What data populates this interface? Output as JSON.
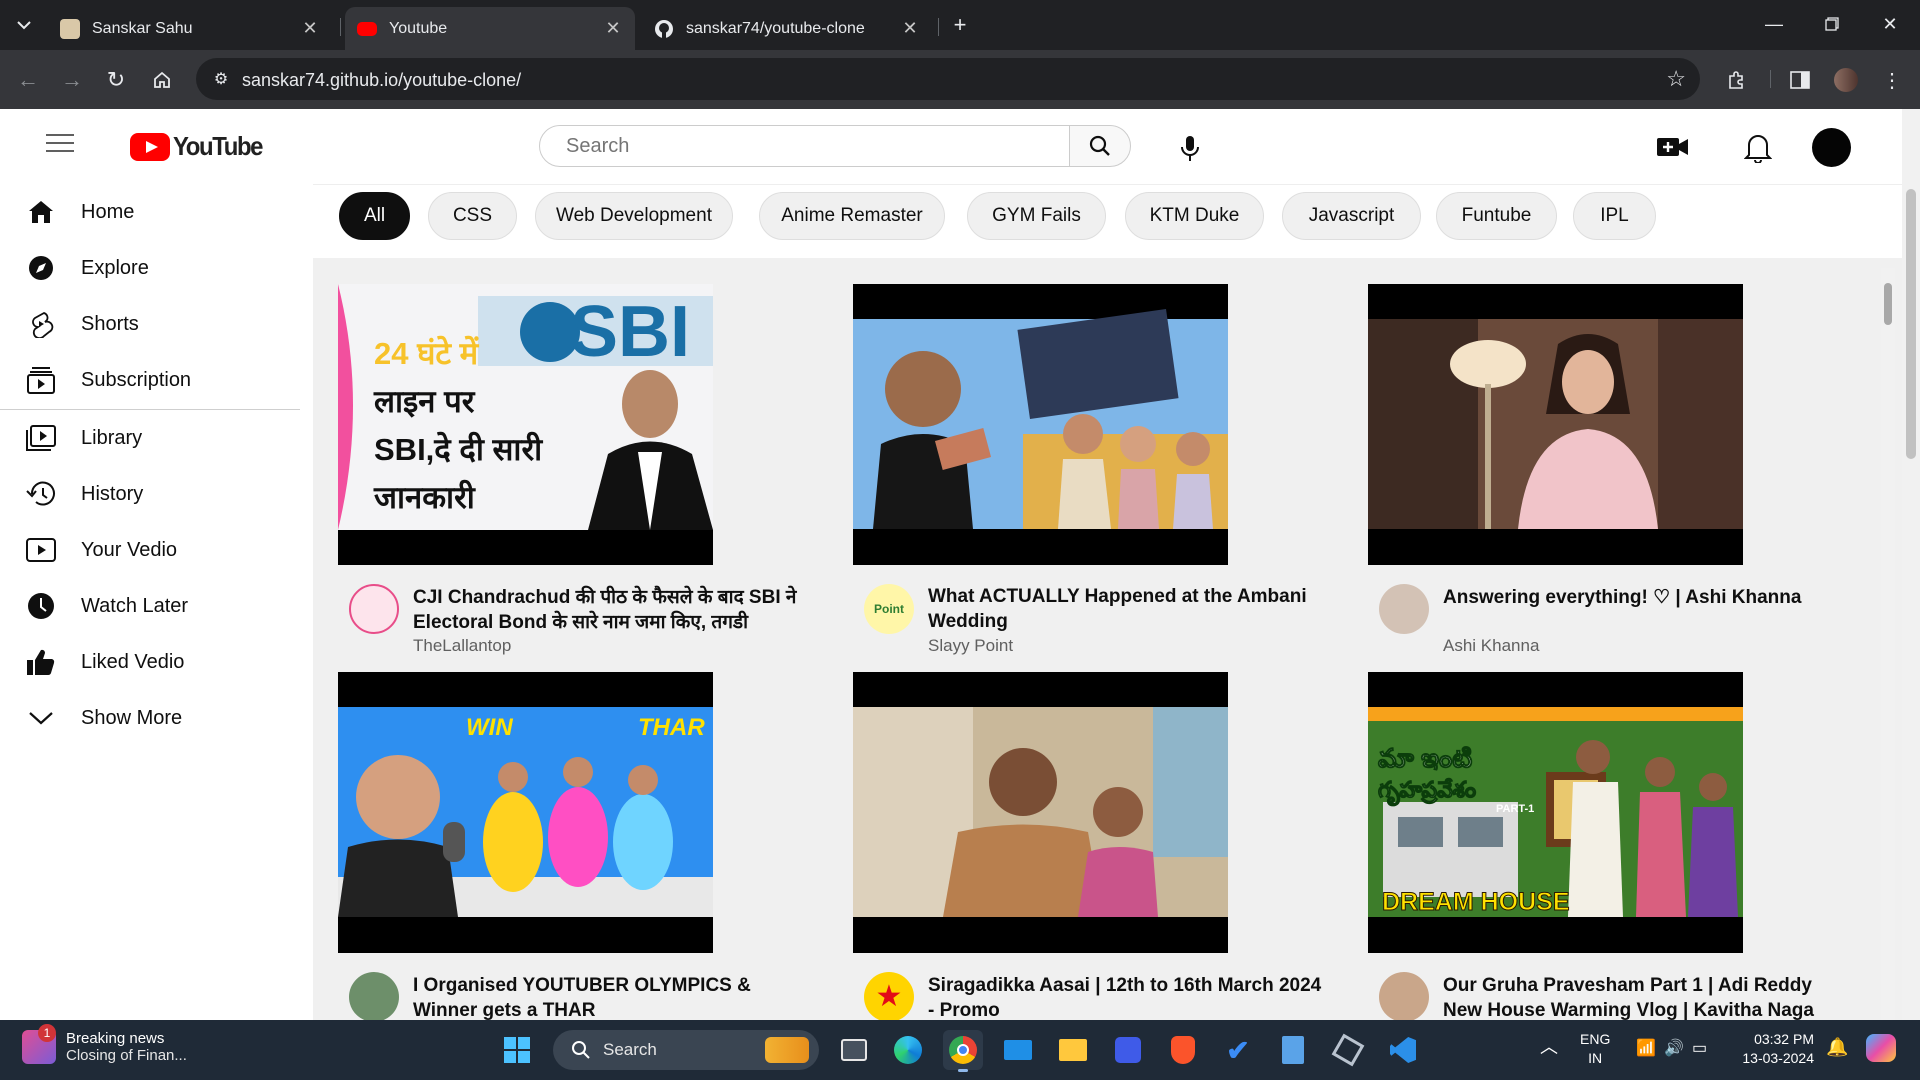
{
  "browser": {
    "tabs": [
      {
        "title": "Sanskar Sahu",
        "active": false
      },
      {
        "title": "Youtube",
        "active": true
      },
      {
        "title": "sanskar74/youtube-clone",
        "active": false
      }
    ],
    "url": "sanskar74.github.io/youtube-clone/"
  },
  "header": {
    "logo_text": "YouTube",
    "search_placeholder": "Search"
  },
  "sidebar": {
    "items": [
      {
        "label": "Home",
        "icon": "home-icon"
      },
      {
        "label": "Explore",
        "icon": "compass-icon"
      },
      {
        "label": "Shorts",
        "icon": "shorts-icon"
      },
      {
        "label": "Subscription",
        "icon": "subscriptions-icon"
      },
      {
        "label": "Library",
        "icon": "library-icon"
      },
      {
        "label": "History",
        "icon": "history-icon"
      },
      {
        "label": "Your Vedio",
        "icon": "your-video-icon"
      },
      {
        "label": "Watch Later",
        "icon": "watch-later-icon"
      },
      {
        "label": "Liked Vedio",
        "icon": "thumbs-up-icon"
      },
      {
        "label": "Show More",
        "icon": "chevron-down-icon"
      }
    ]
  },
  "chips": [
    "All",
    "CSS",
    "Web Development",
    "Anime Remaster",
    "GYM Fails",
    "KTM Duke",
    "Javascript",
    "Funtube",
    "IPL"
  ],
  "videos": [
    {
      "title": "CJI Chandrachud की पीठ के फैसले के बाद SBI ने Electoral Bond के सारे नाम जमा किए, तगडी",
      "channel": "TheLallantop",
      "thumb_text": [
        "24 घंटे में",
        "लाइन पर",
        "SBI,दे दी सारी",
        "जानकारी"
      ],
      "thumb_logo": "SBI"
    },
    {
      "title": "What ACTUALLY Happened at the Ambani Wedding",
      "channel": "Slayy Point",
      "avatar_text": "Point"
    },
    {
      "title": "Answering everything! ♡ | Ashi Khanna",
      "channel": "Ashi Khanna"
    },
    {
      "title": "I Organised YOUTUBER OLYMPICS & Winner gets a THAR",
      "channel": "",
      "thumb_text": [
        "WIN",
        "THAR"
      ]
    },
    {
      "title": "Siragadikka Aasai | 12th to 16th March 2024 - Promo",
      "channel": ""
    },
    {
      "title": "Our Gruha Pravesham Part 1 | Adi Reddy New House Warming Vlog | Kavitha Naga",
      "channel": "",
      "thumb_text": [
        "మా ఇంటి",
        "గృహప్రవేశం",
        "PART-1",
        "DREAM HOUSE"
      ]
    }
  ],
  "taskbar": {
    "news_title": "Breaking news",
    "news_sub": "Closing of Finan...",
    "news_badge": "1",
    "search_label": "Search",
    "lang_top": "ENG",
    "lang_bottom": "IN",
    "time": "03:32 PM",
    "date": "13-03-2024"
  },
  "colors": {
    "youtube_red": "#ff0000",
    "chrome_dark": "#202124",
    "feed_bg": "#f0f0f0",
    "taskbar": "#1f2a37"
  }
}
